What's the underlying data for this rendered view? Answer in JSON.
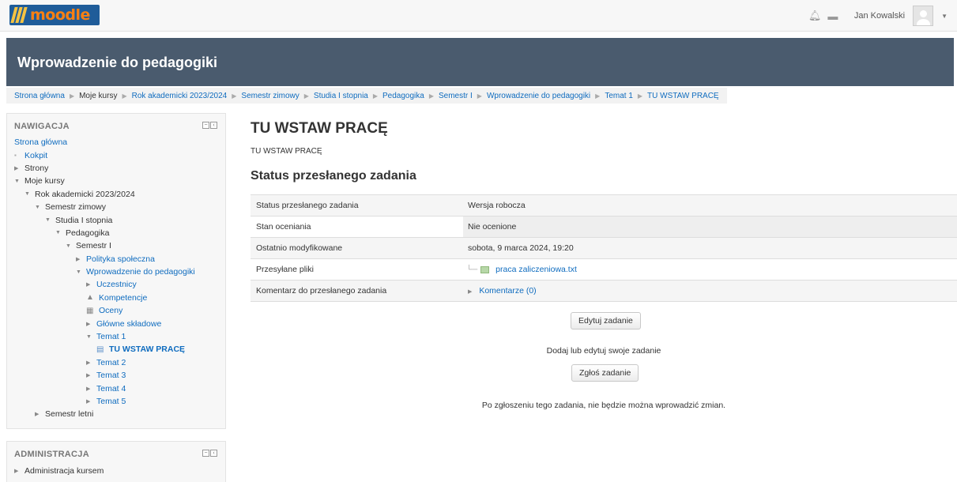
{
  "navbar": {
    "logo_text": "moodle",
    "user_name": "Jan Kowalski"
  },
  "course": {
    "title": "Wprowadzenie do pedagogiki"
  },
  "breadcrumb": [
    {
      "label": "Strona główna",
      "link": true
    },
    {
      "label": "Moje kursy",
      "link": false
    },
    {
      "label": "Rok akademicki 2023/2024",
      "link": true
    },
    {
      "label": "Semestr zimowy",
      "link": true
    },
    {
      "label": "Studia I stopnia",
      "link": true
    },
    {
      "label": "Pedagogika",
      "link": true
    },
    {
      "label": "Semestr I",
      "link": true
    },
    {
      "label": "Wprowadzenie do pedagogiki",
      "link": true
    },
    {
      "label": "Temat 1",
      "link": true
    },
    {
      "label": "TU WSTAW PRACĘ",
      "link": true
    }
  ],
  "navigation": {
    "title": "NAWIGACJA",
    "items": [
      {
        "label": "Strona główna",
        "level": 0,
        "marker": "none",
        "link": true
      },
      {
        "label": "Kokpit",
        "level": 0,
        "marker": "bullet",
        "link": true
      },
      {
        "label": "Strony",
        "level": 0,
        "marker": "collapsed",
        "link": false
      },
      {
        "label": "Moje kursy",
        "level": 0,
        "marker": "expanded",
        "link": false
      },
      {
        "label": "Rok akademicki 2023/2024",
        "level": 1,
        "marker": "expanded",
        "link": false
      },
      {
        "label": "Semestr zimowy",
        "level": 2,
        "marker": "expanded",
        "link": false
      },
      {
        "label": "Studia I stopnia",
        "level": 3,
        "marker": "expanded",
        "link": false
      },
      {
        "label": "Pedagogika",
        "level": 4,
        "marker": "expanded",
        "link": false
      },
      {
        "label": "Semestr I",
        "level": 5,
        "marker": "expanded",
        "link": false
      },
      {
        "label": "Polityka społeczna",
        "level": 6,
        "marker": "collapsed",
        "link": true
      },
      {
        "label": "Wprowadzenie do pedagogiki",
        "level": 6,
        "marker": "expanded",
        "link": true
      },
      {
        "label": "Uczestnicy",
        "level": 7,
        "marker": "collapsed",
        "link": true
      },
      {
        "label": "Kompetencje",
        "level": 7,
        "marker": "icon-competency",
        "link": true
      },
      {
        "label": "Oceny",
        "level": 7,
        "marker": "icon-grades",
        "link": true
      },
      {
        "label": "Główne składowe",
        "level": 7,
        "marker": "collapsed",
        "link": true
      },
      {
        "label": "Temat 1",
        "level": 7,
        "marker": "expanded",
        "link": true
      },
      {
        "label": "TU WSTAW PRACĘ",
        "level": 8,
        "marker": "icon-assignment",
        "link": true,
        "current": true
      },
      {
        "label": "Temat 2",
        "level": 7,
        "marker": "collapsed",
        "link": true
      },
      {
        "label": "Temat 3",
        "level": 7,
        "marker": "collapsed",
        "link": true
      },
      {
        "label": "Temat 4",
        "level": 7,
        "marker": "collapsed",
        "link": true
      },
      {
        "label": "Temat 5",
        "level": 7,
        "marker": "collapsed",
        "link": true
      },
      {
        "label": "Semestr letni",
        "level": 2,
        "marker": "collapsed",
        "link": false
      }
    ]
  },
  "administration": {
    "title": "ADMINISTRACJA",
    "items": [
      {
        "label": "Administracja kursem",
        "marker": "collapsed"
      }
    ]
  },
  "main": {
    "heading": "TU WSTAW PRACĘ",
    "intro": "TU WSTAW PRACĘ",
    "status_heading": "Status przesłanego zadania",
    "rows": [
      {
        "key": "Status przesłanego zadania",
        "value": "Wersja robocza"
      },
      {
        "key": "Stan oceniania",
        "value": "Nie ocenione"
      },
      {
        "key": "Ostatnio modyfikowane",
        "value": "sobota, 9 marca 2024, 19:20"
      },
      {
        "key": "Przesyłane pliki",
        "value": "praca zaliczeniowa.txt"
      },
      {
        "key": "Komentarz do przesłanego zadania",
        "value": "Komentarze (0)"
      }
    ],
    "edit_button": "Edytuj zadanie",
    "add_text": "Dodaj lub edytuj swoje zadanie",
    "submit_button": "Zgłoś zadanie",
    "warning_text": "Po zgłoszeniu tego zadania, nie będzie można wprowadzić zmian."
  },
  "colors": {
    "header_bg": "#4a5b6e",
    "link": "#0f6cbf",
    "moodle_orange": "#f98012"
  }
}
